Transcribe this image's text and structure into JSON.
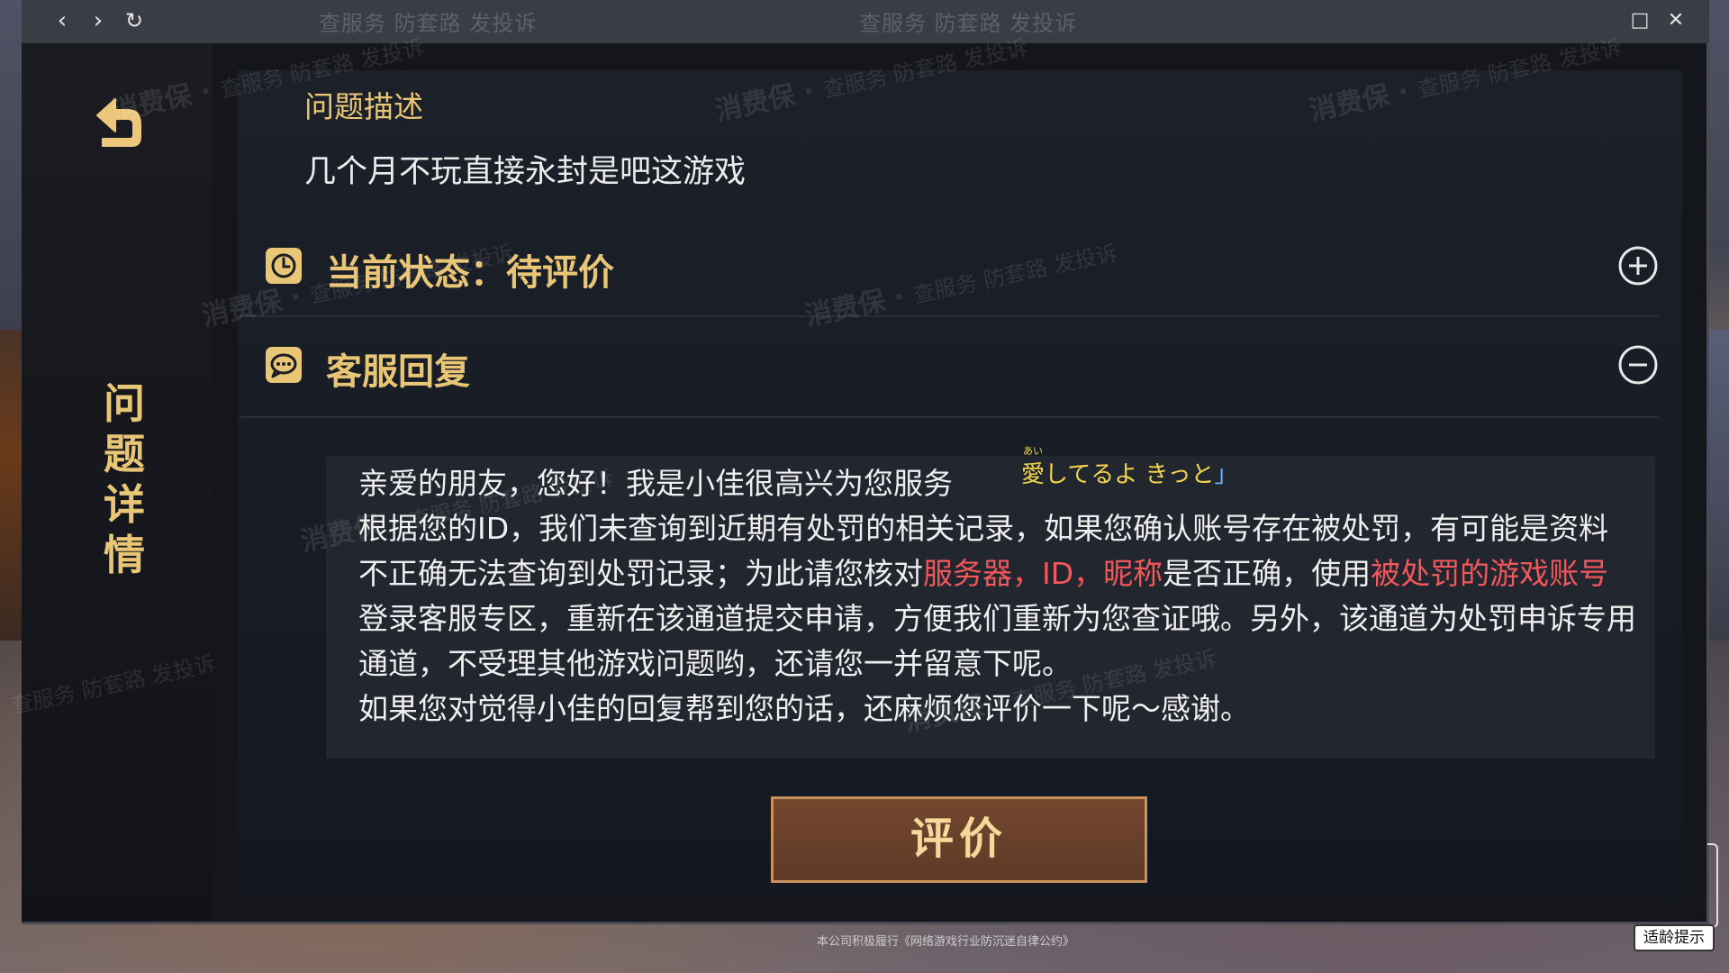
{
  "browser": {
    "back_symbol": "‹",
    "forward_symbol": "›",
    "reload_symbol": "↻",
    "maximize_symbol": "□",
    "close_symbol": "✕"
  },
  "sidebar": {
    "back_icon": "return-arrow-icon",
    "title_chars": [
      "问",
      "题",
      "详",
      "情"
    ]
  },
  "question": {
    "label": "问题描述",
    "text": "几个月不玩直接永封是吧这游戏"
  },
  "status": {
    "icon": "clock-icon",
    "label": "当前状态：待评价",
    "toggle_icon": "plus-circle-icon"
  },
  "reply": {
    "icon": "chat-bubble-icon",
    "label": "客服回复",
    "toggle_icon": "minus-circle-icon",
    "line1": "亲爱的朋友，您好！我是小佳很高兴为您服务",
    "p2_a": "根据您的ID，我们未查询到近期有处罚的相关记录，如果您确认账号存在被处罚，有可能是资料不正确无法查询到处罚记录；为此请您核对",
    "p2_hl1": "服务器，ID，昵称",
    "p2_b": "是否正确，使用",
    "p2_hl2": "被处罚的游戏账号",
    "p2_c": "登录客服专区，重新在该通道提交申请，方便我们重新为您查证哦。另外，该通道为处罚申诉专用通道，不受理其他游戏问题哟，还请您一并留意下呢。",
    "line3": "如果您对觉得小佳的回复帮到您的话，还麻烦您评价一下呢～感谢。"
  },
  "evaluate_button": "评价",
  "overlay_subtitle": {
    "ruby": "あい",
    "main": "愛してるよ きっと",
    "tail": "」"
  },
  "watermark": {
    "brand": "消费保",
    "tagline": "查服务 防套路 发投诉"
  },
  "footer": {
    "text": "本公司积极履行《网络游戏行业防沉迷自律公约》",
    "age_badge": "适龄提示"
  },
  "colors": {
    "gold": "#e9c675",
    "highlight_red": "#f2575a",
    "button_border": "#c9925c"
  }
}
